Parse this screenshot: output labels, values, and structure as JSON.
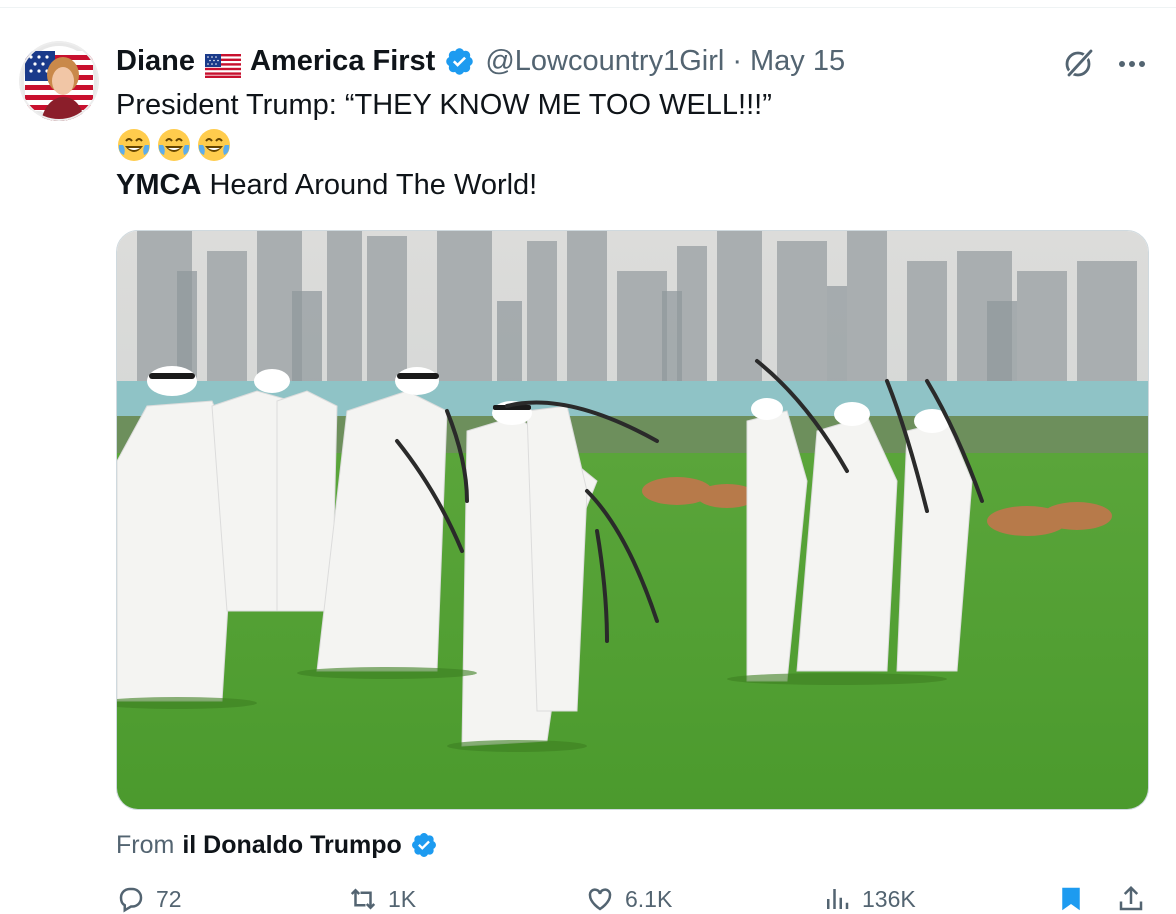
{
  "post": {
    "display_name_first": "Diane",
    "display_name_second": "America First",
    "handle": "@Lowcountry1Girl",
    "separator": "·",
    "date": "May 15",
    "text_line1": "President Trump: “THEY KNOW ME TOO WELL!!!”",
    "text_line3_bold": "YMCA",
    "text_line3_rest": " Heard Around The World!",
    "media_description": "video",
    "source_prefix": "From",
    "source_name": "il Donaldo Trumpo"
  },
  "actions": {
    "replies": "72",
    "reposts": "1K",
    "likes": "6.1K",
    "views": "136K"
  },
  "icons": [
    "us-flag-emoji",
    "verified-badge-icon",
    "grok-icon",
    "more-icon",
    "laughing-crying-emoji",
    "reply-icon",
    "repost-icon",
    "like-icon",
    "views-icon",
    "bookmark-icon",
    "share-icon"
  ],
  "colors": {
    "verified": "#1d9bf0",
    "secondary_text": "#536471",
    "primary_text": "#0f1419",
    "bookmark_active": "#1d9bf0"
  }
}
